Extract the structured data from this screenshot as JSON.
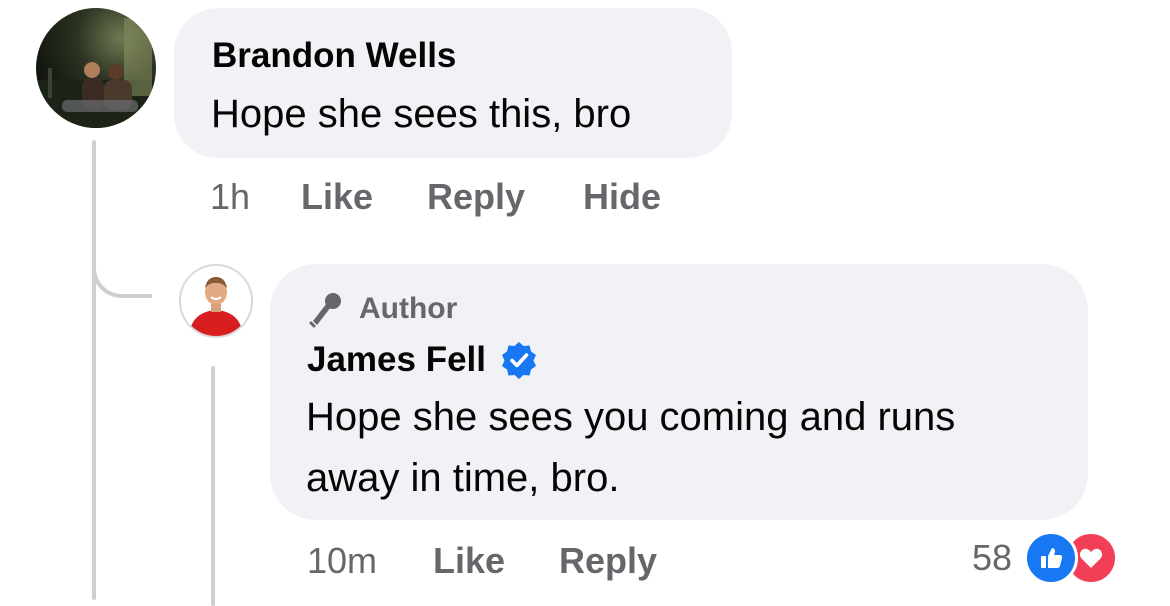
{
  "comment": {
    "author": "Brandon Wells",
    "text": "Hope she sees this, bro",
    "time": "1h",
    "actions": {
      "like": "Like",
      "reply": "Reply",
      "hide": "Hide"
    }
  },
  "reply": {
    "badge": "Author",
    "badge_icon": "microphone-icon",
    "author": "James Fell",
    "verified_icon": "verified-badge-icon",
    "text_lines": [
      "Hope she sees you coming and runs",
      "away in time, bro."
    ],
    "time": "10m",
    "actions": {
      "like": "Like",
      "reply": "Reply"
    },
    "reaction_count": "58",
    "reactions": [
      "like-reaction-icon",
      "love-reaction-icon"
    ]
  },
  "colors": {
    "bubble": "#f0f2f5",
    "secondary_text": "#65676b",
    "verified": "#1877f2",
    "like": "#1877f2",
    "love": "#f33e58",
    "thread_line": "#ccd0d5"
  }
}
